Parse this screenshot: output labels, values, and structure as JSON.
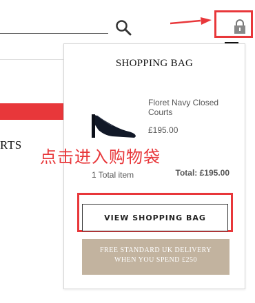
{
  "header": {
    "search_icon": "search-icon",
    "bag_icon": "padlock-bag-icon"
  },
  "page": {
    "partial_text": "RTS"
  },
  "dropdown": {
    "title": "SHOPPING BAG",
    "product": {
      "name": "Floret Navy Closed Courts",
      "price": "£195.00"
    },
    "total_items": "1 Total item",
    "total_price": "Total: £195.00",
    "view_bag_label": "VIEW SHOPPING BAG",
    "delivery_line1": "FREE STANDARD UK DELIVERY",
    "delivery_line2": "WHEN YOU SPEND £250"
  },
  "annotation": {
    "text": "点击进入购物袋",
    "color": "#e8373a"
  },
  "colors": {
    "accent_red": "#e8373a",
    "banner_beige": "#c2b39f"
  }
}
